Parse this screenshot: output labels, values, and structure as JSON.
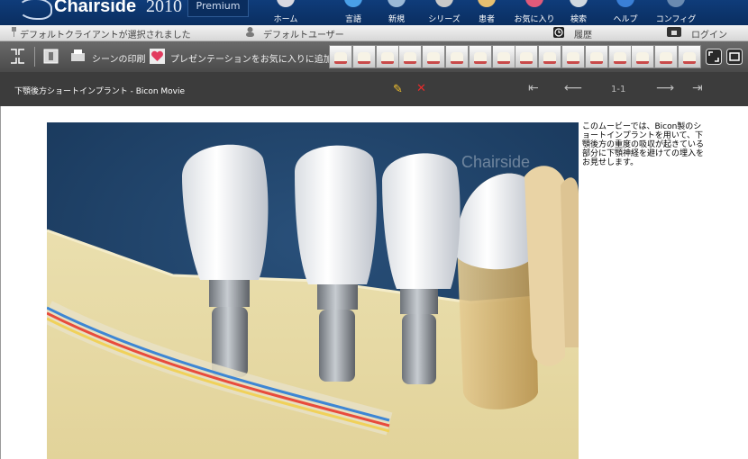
{
  "header": {
    "brand": "Chairside",
    "year": "2010",
    "edition": "Premium",
    "nav": [
      {
        "label": "ホーム",
        "icon": "home-icon",
        "color": "#d8d8e0"
      },
      {
        "label": "言語",
        "icon": "language-icon",
        "color": "#4aa0e8"
      },
      {
        "label": "新規",
        "icon": "new-icon",
        "color": "#9ab8d6"
      },
      {
        "label": "シリーズ",
        "icon": "series-icon",
        "color": "#c9c9c9"
      },
      {
        "label": "患者",
        "icon": "patient-icon",
        "color": "#e8c070"
      },
      {
        "label": "お気に入り",
        "icon": "favorites-icon",
        "color": "#e05a7a"
      },
      {
        "label": "検索",
        "icon": "search-icon",
        "color": "#d0d8e0"
      },
      {
        "label": "ヘルプ",
        "icon": "help-icon",
        "color": "#3a7fd6"
      },
      {
        "label": "コンフィグ",
        "icon": "config-icon",
        "color": "#6a8ab0"
      }
    ]
  },
  "userbar": {
    "client_status": "デフォルトクライアントが選択されました",
    "default_user": "デフォルトユーザー",
    "history": "履歴",
    "login": "ログイン"
  },
  "toolbar": {
    "print_label": "シーンの印刷",
    "favorite_label": "プレゼンテーションをお気に入りに追加",
    "thumbnail_count": 16
  },
  "titlebar": {
    "title": "下顎後方ショートインプラント - Bicon Movie",
    "page": "1-1"
  },
  "content": {
    "watermark": "Chairside",
    "description": "このムービーでは、Bicon製のショートインプラントを用いて、下顎後方の重度の吸収が起きている部分に下顎神経を避けての埋入をお見せします。"
  }
}
